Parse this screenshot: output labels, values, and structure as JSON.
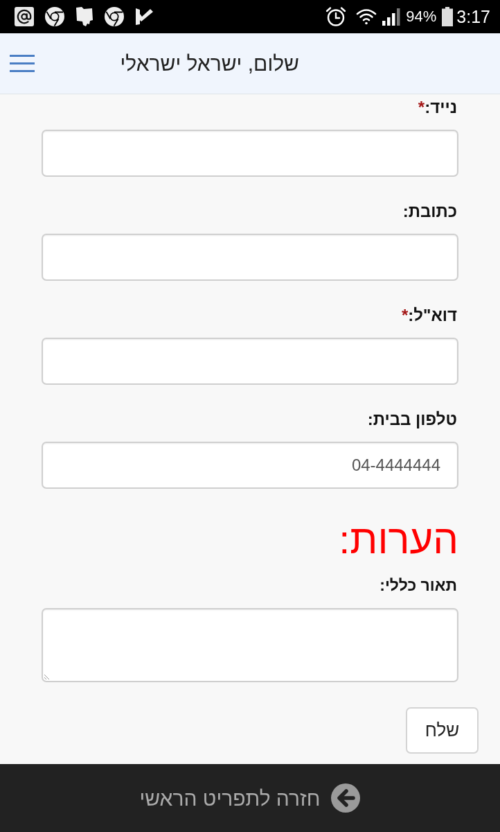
{
  "status_bar": {
    "battery_percent": "94%",
    "time": "3:17"
  },
  "header": {
    "title": "שלום, ישראל ישראלי"
  },
  "form": {
    "fields": [
      {
        "label": "נייד:",
        "required_mark": "*"
      },
      {
        "label": "כתובת:"
      },
      {
        "label": "דוא\"ל:",
        "required_mark": "*"
      },
      {
        "label": "טלפון בבית:",
        "value": "04-4444444"
      }
    ],
    "notes_heading": "הערות:",
    "notes_field": {
      "label": "תאור כללי:"
    },
    "submit_button": "שלח"
  },
  "footer": {
    "back_link": "חזרה לתפריט הראשי"
  }
}
